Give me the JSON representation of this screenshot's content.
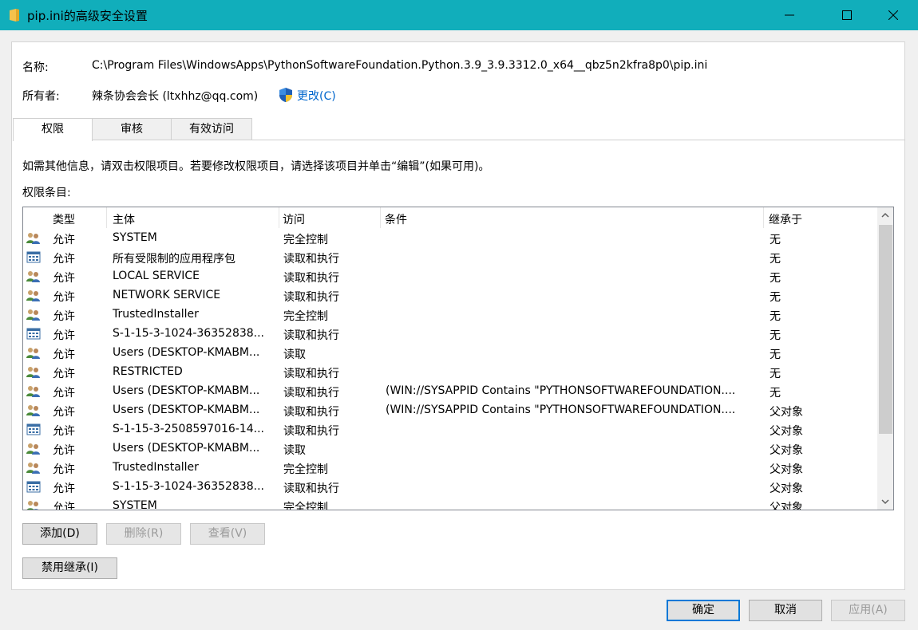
{
  "window": {
    "title": "pip.ini的高级安全设置"
  },
  "info": {
    "name_label": "名称:",
    "name_value": "C:\\Program Files\\WindowsApps\\PythonSoftwareFoundation.Python.3.9_3.9.3312.0_x64__qbz5n2kfra8p0\\pip.ini",
    "owner_label": "所有者:",
    "owner_value": "辣条协会会长 (ltxhhz@qq.com)",
    "change_link": "更改(C)"
  },
  "tabs": [
    "权限",
    "审核",
    "有效访问"
  ],
  "instructions": "如需其他信息，请双击权限项目。若要修改权限项目，请选择该项目并单击“编辑”(如果可用)。",
  "list_label": "权限条目:",
  "columns": [
    "类型",
    "主体",
    "访问",
    "条件",
    "继承于"
  ],
  "rows": [
    {
      "icon": "user-group-icon",
      "type": "允许",
      "principal": "SYSTEM",
      "access": "完全控制",
      "condition": "",
      "inherited": "无"
    },
    {
      "icon": "app-package-icon",
      "type": "允许",
      "principal": "所有受限制的应用程序包",
      "access": "读取和执行",
      "condition": "",
      "inherited": "无"
    },
    {
      "icon": "user-group-icon",
      "type": "允许",
      "principal": "LOCAL SERVICE",
      "access": "读取和执行",
      "condition": "",
      "inherited": "无"
    },
    {
      "icon": "user-group-icon",
      "type": "允许",
      "principal": "NETWORK SERVICE",
      "access": "读取和执行",
      "condition": "",
      "inherited": "无"
    },
    {
      "icon": "user-group-icon",
      "type": "允许",
      "principal": "TrustedInstaller",
      "access": "完全控制",
      "condition": "",
      "inherited": "无"
    },
    {
      "icon": "app-package-icon",
      "type": "允许",
      "principal": "S-1-15-3-1024-36352838...",
      "access": "读取和执行",
      "condition": "",
      "inherited": "无"
    },
    {
      "icon": "user-group-icon",
      "type": "允许",
      "principal": "Users (DESKTOP-KMABM...",
      "access": "读取",
      "condition": "",
      "inherited": "无"
    },
    {
      "icon": "user-group-icon",
      "type": "允许",
      "principal": "RESTRICTED",
      "access": "读取和执行",
      "condition": "",
      "inherited": "无"
    },
    {
      "icon": "user-group-icon",
      "type": "允许",
      "principal": "Users (DESKTOP-KMABM...",
      "access": "读取和执行",
      "condition": "(WIN://SYSAPPID Contains \"PYTHONSOFTWAREFOUNDATION....",
      "inherited": "无"
    },
    {
      "icon": "user-group-icon",
      "type": "允许",
      "principal": "Users (DESKTOP-KMABM...",
      "access": "读取和执行",
      "condition": "(WIN://SYSAPPID Contains \"PYTHONSOFTWAREFOUNDATION....",
      "inherited": "父对象"
    },
    {
      "icon": "app-package-icon",
      "type": "允许",
      "principal": "S-1-15-3-2508597016-14...",
      "access": "读取和执行",
      "condition": "",
      "inherited": "父对象"
    },
    {
      "icon": "user-group-icon",
      "type": "允许",
      "principal": "Users (DESKTOP-KMABM...",
      "access": "读取",
      "condition": "",
      "inherited": "父对象"
    },
    {
      "icon": "user-group-icon",
      "type": "允许",
      "principal": "TrustedInstaller",
      "access": "完全控制",
      "condition": "",
      "inherited": "父对象"
    },
    {
      "icon": "app-package-icon",
      "type": "允许",
      "principal": "S-1-15-3-1024-36352838...",
      "access": "读取和执行",
      "condition": "",
      "inherited": "父对象"
    },
    {
      "icon": "user-group-icon",
      "type": "允许",
      "principal": "SYSTEM",
      "access": "完全控制",
      "condition": "",
      "inherited": "父对象"
    }
  ],
  "buttons": {
    "add": "添加(D)",
    "remove": "删除(R)",
    "view": "查看(V)",
    "disable_inheritance": "禁用继承(I)",
    "ok": "确定",
    "cancel": "取消",
    "apply": "应用(A)"
  },
  "colors": {
    "titlebar": "#11aebb",
    "link": "#0066cc",
    "default_button_border": "#0078d7"
  }
}
